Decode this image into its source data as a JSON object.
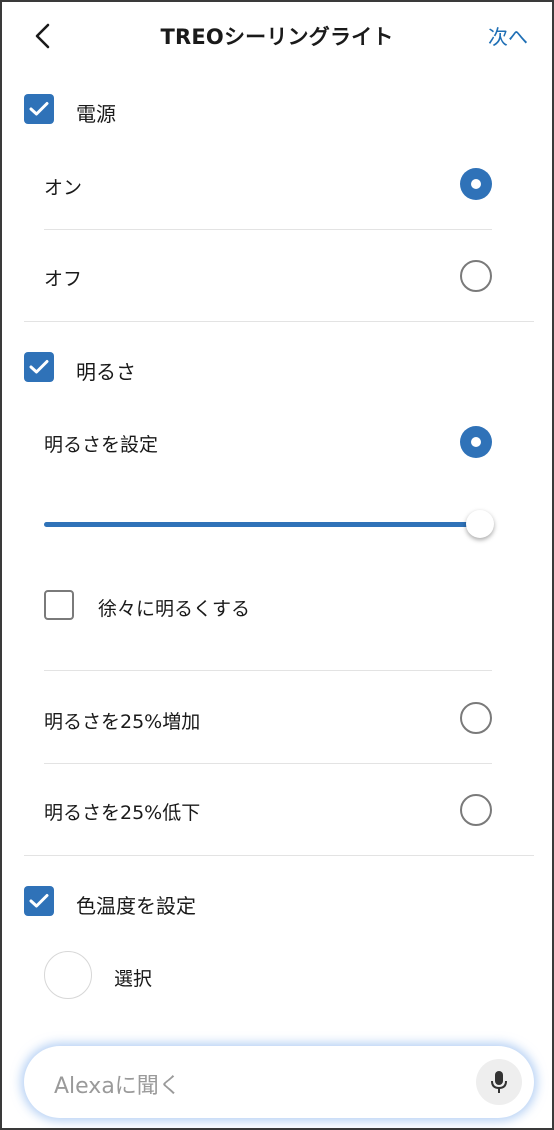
{
  "header": {
    "title": "TREOシーリングライト",
    "next_label": "次へ"
  },
  "power": {
    "label": "電源",
    "checked": true,
    "options": [
      {
        "label": "オン",
        "selected": true
      },
      {
        "label": "オフ",
        "selected": false
      }
    ]
  },
  "brightness": {
    "label": "明るさ",
    "checked": true,
    "set_label": "明るさを設定",
    "set_selected": true,
    "slider_value_fraction": 1.0,
    "gradual_label": "徐々に明るくする",
    "gradual_checked": false,
    "increase_label": "明るさを25%増加",
    "increase_selected": false,
    "decrease_label": "明るさを25%低下",
    "decrease_selected": false
  },
  "color_temperature": {
    "label": "色温度を設定",
    "checked": true,
    "select_label": "選択"
  },
  "alexa_bar": {
    "placeholder": "Alexaに聞く",
    "mic_icon": "microphone-icon"
  },
  "colors": {
    "accent": "#2f72b8",
    "link": "#1f6fb5",
    "unchecked_border": "#7a7a7a",
    "divider": "#e3e3e3"
  }
}
